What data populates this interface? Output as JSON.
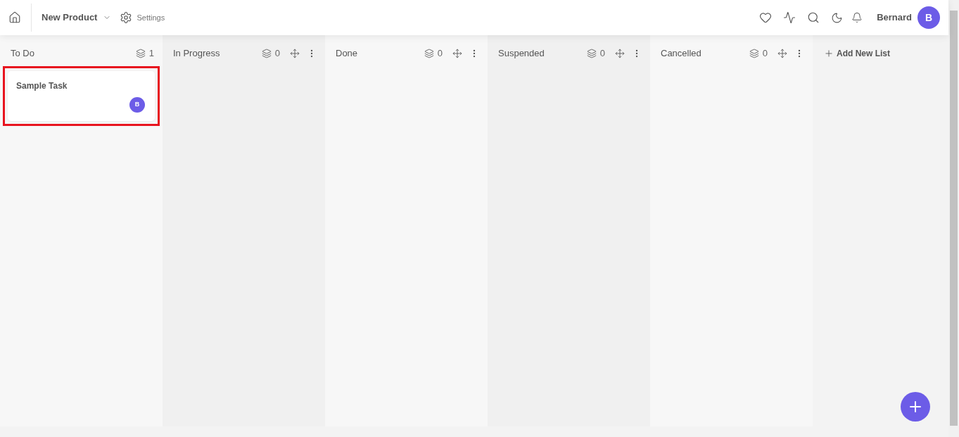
{
  "header": {
    "project": "New Product",
    "settings": "Settings",
    "user": {
      "name": "Bernard",
      "initial": "B"
    }
  },
  "lists": [
    {
      "title": "To Do",
      "count": "1",
      "movable": false,
      "cards": [
        {
          "title": "Sample Task",
          "assignee": "B",
          "highlighted": true
        }
      ]
    },
    {
      "title": "In Progress",
      "count": "0",
      "movable": true
    },
    {
      "title": "Done",
      "count": "0",
      "movable": true
    },
    {
      "title": "Suspended",
      "count": "0",
      "movable": true
    },
    {
      "title": "Cancelled",
      "count": "0",
      "movable": true
    }
  ],
  "add_list": "Add New List"
}
